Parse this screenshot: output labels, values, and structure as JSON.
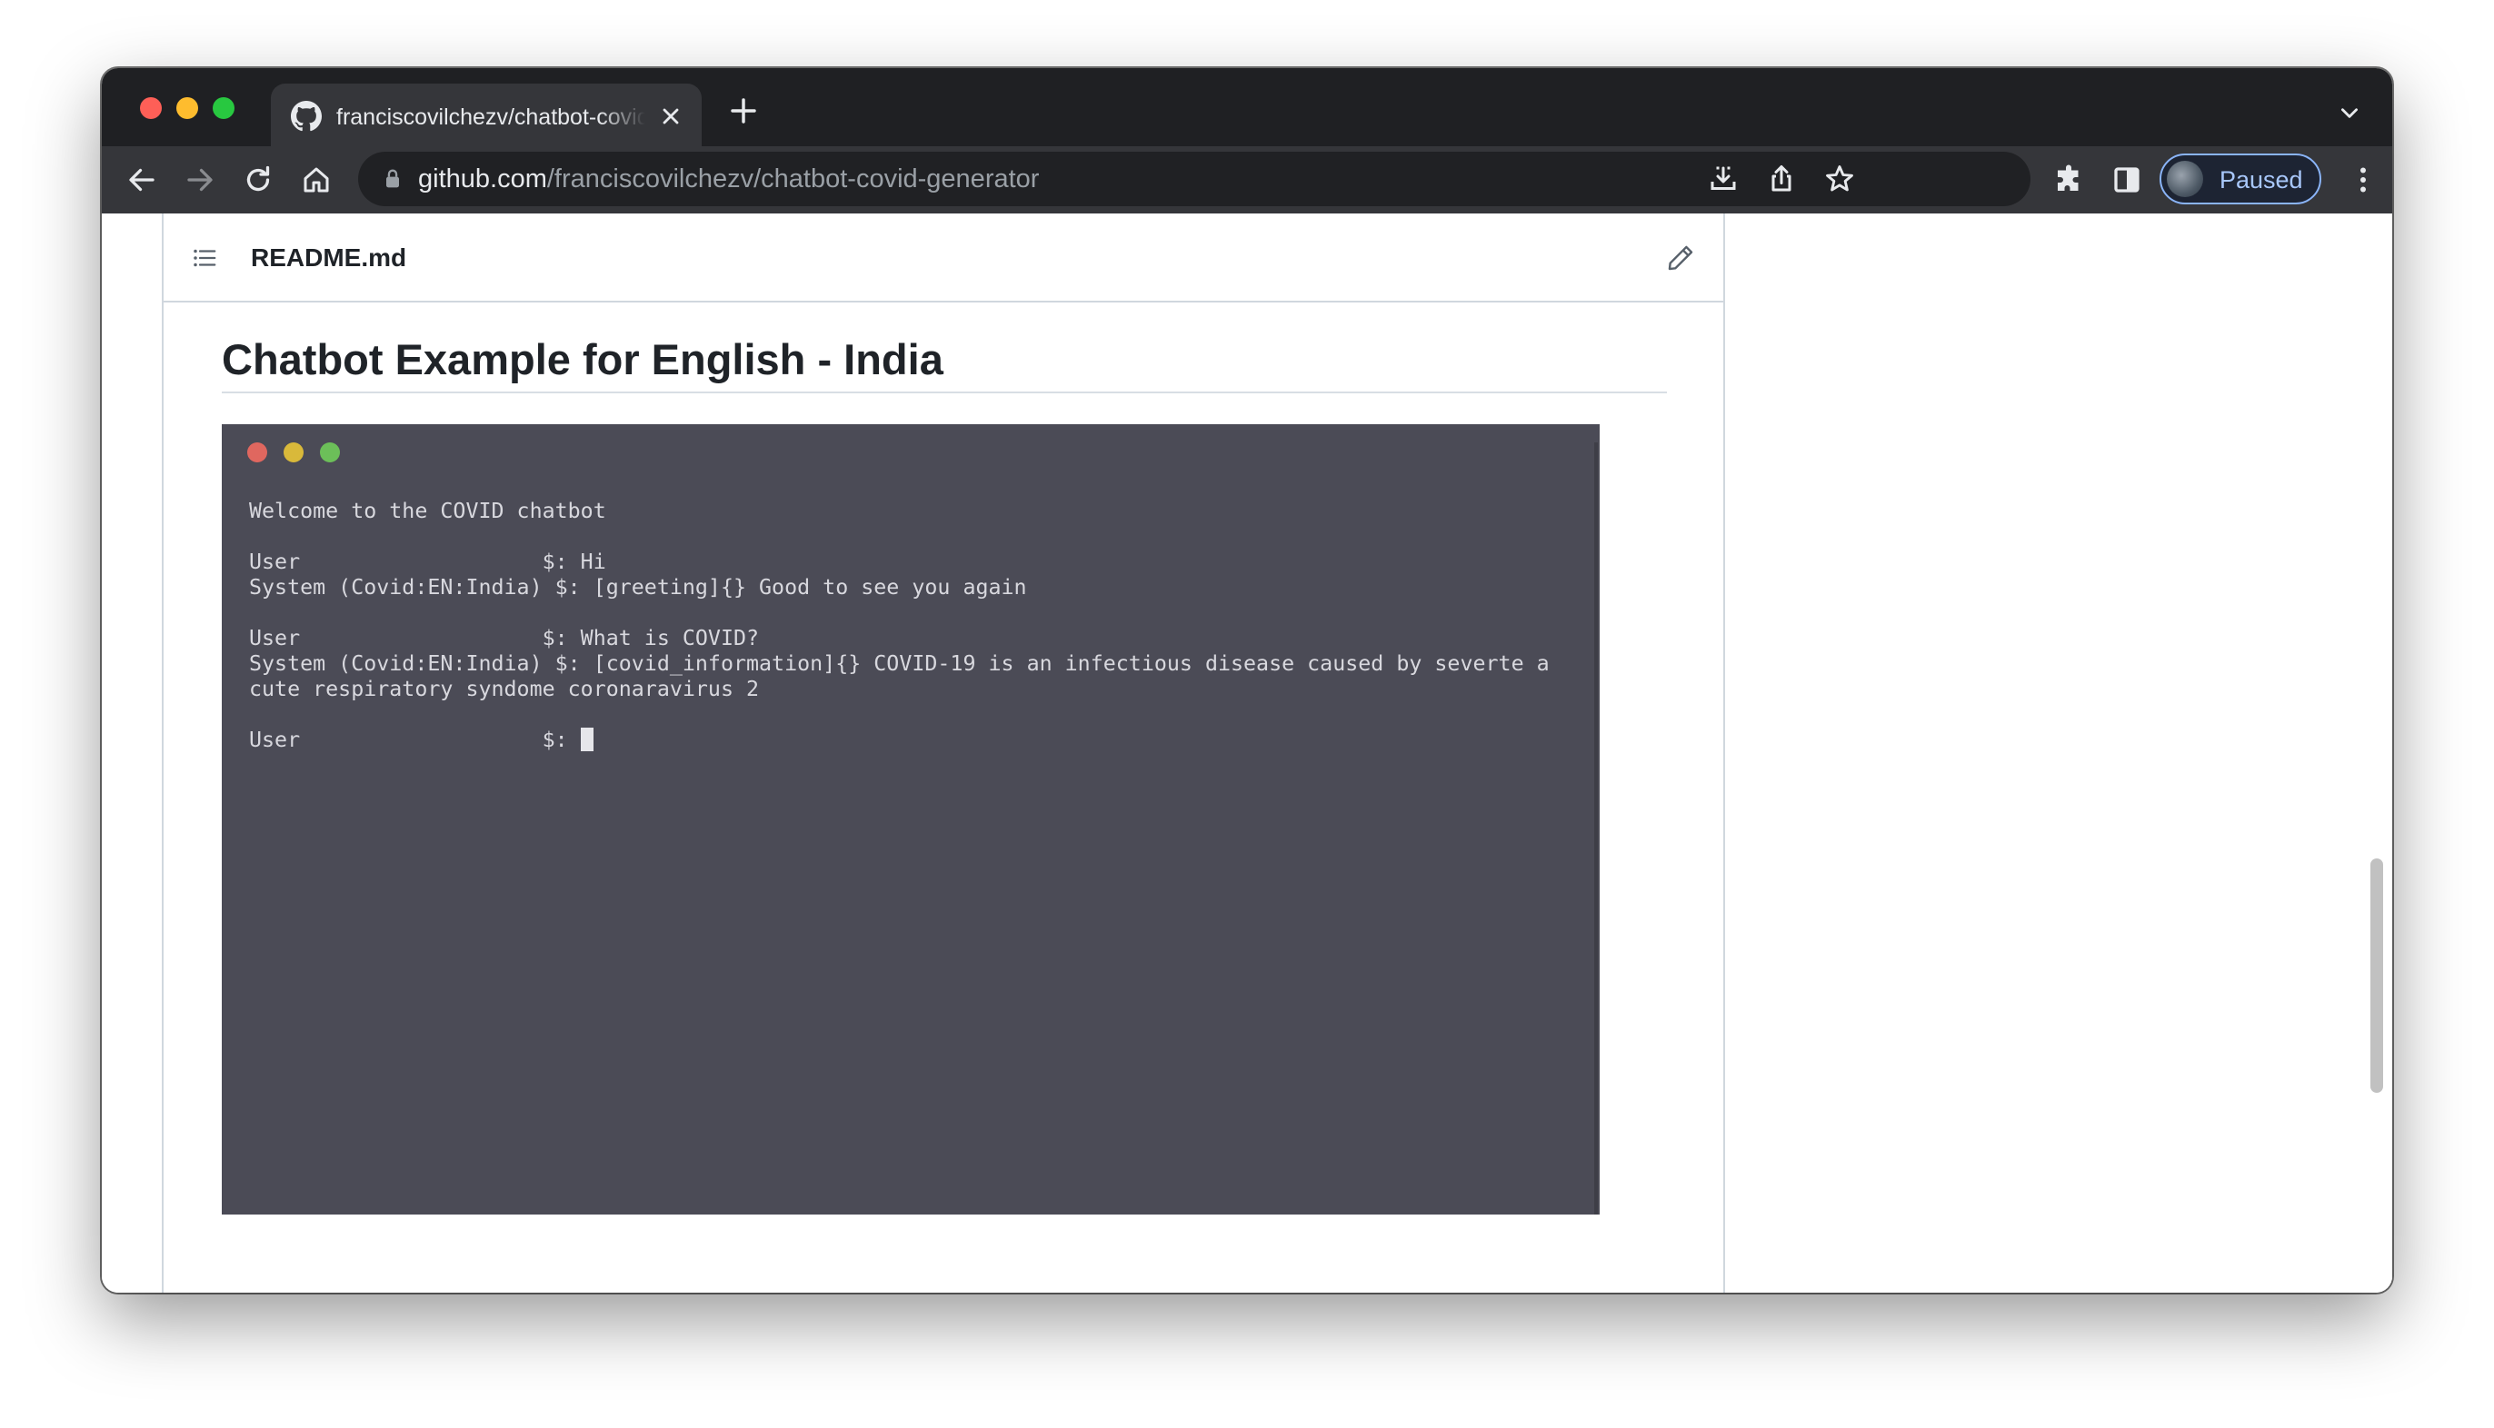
{
  "browser": {
    "tab": {
      "title": "franciscovilchezv/chatbot-covid-generator",
      "favicon": "github-icon"
    },
    "address": {
      "host": "github.com",
      "path": "/franciscovilchezv/chatbot-covid-generator"
    },
    "profile": {
      "status": "Paused"
    }
  },
  "readme": {
    "file_name": "README.md",
    "heading": "Chatbot Example for English - India",
    "terminal": {
      "lines": [
        "Welcome to the COVID chatbot",
        "",
        "User                   $: Hi",
        "System (Covid:EN:India) $: [greeting]{} Good to see you again",
        "",
        "User                   $: What is COVID?",
        "System (Covid:EN:India) $: [covid_information]{} COVID-19 is an infectious disease caused by severte a",
        "cute respiratory syndome coronaravirus 2",
        "",
        "User                   $: "
      ]
    }
  },
  "colors": {
    "terminal_bg": "#4b4b56",
    "chrome_dark": "#35363a",
    "accent": "#8ab4f8"
  }
}
